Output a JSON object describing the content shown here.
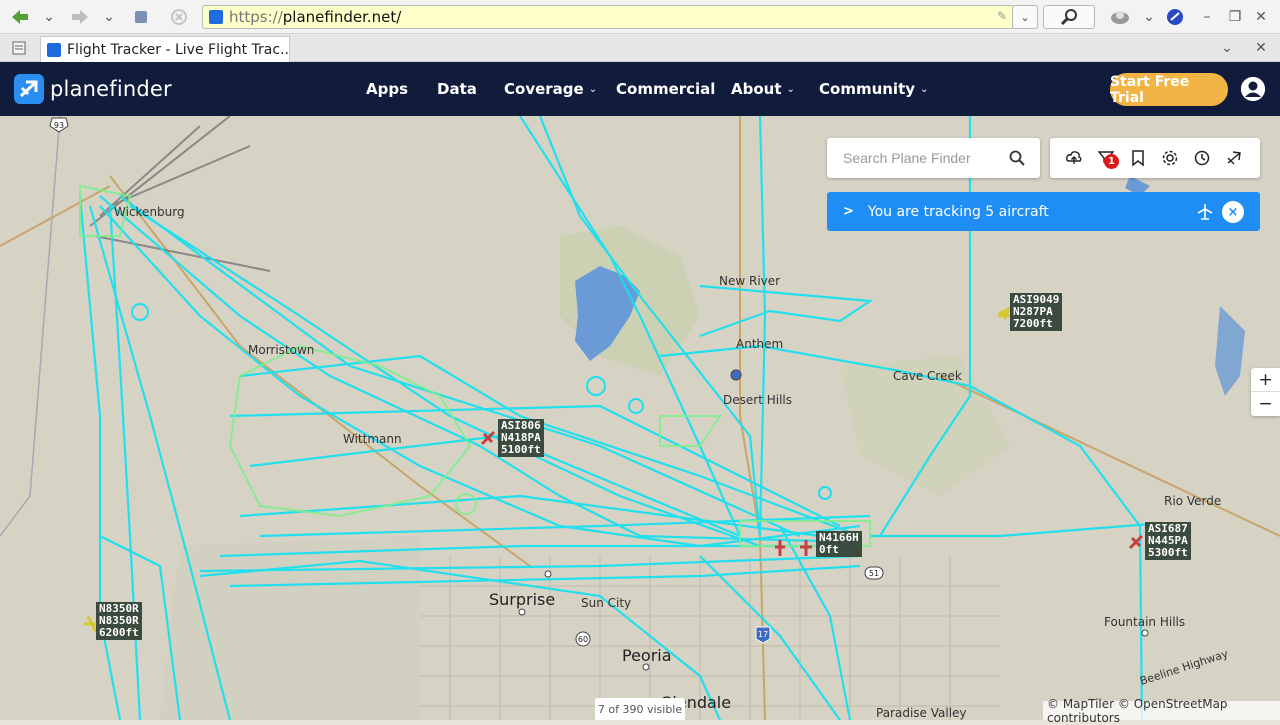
{
  "browser": {
    "url_scheme": "https://",
    "url_host": "planefinder.net/",
    "tab_title": "Flight Tracker - Live Flight Trac..."
  },
  "header": {
    "logo_text": "planefinder",
    "nav": [
      {
        "label": "Apps",
        "has_dropdown": false
      },
      {
        "label": "Data",
        "has_dropdown": false
      },
      {
        "label": "Coverage",
        "has_dropdown": true
      },
      {
        "label": "Commercial",
        "has_dropdown": false
      },
      {
        "label": "About",
        "has_dropdown": true
      },
      {
        "label": "Community",
        "has_dropdown": true
      }
    ],
    "trial_button": "Start Free Trial",
    "accent_color": "#f2b545",
    "bg_color": "#111b3c"
  },
  "search": {
    "placeholder": "Search Plane Finder"
  },
  "tools": {
    "icons": [
      "cloud-upload-icon",
      "filter-icon",
      "bookmark-icon",
      "settings-icon",
      "history-icon",
      "playback-icon"
    ],
    "alert_count": "1"
  },
  "tracking": {
    "text": "You are tracking 5 aircraft",
    "arrow": ">",
    "close": "×"
  },
  "zoom": {
    "in": "+",
    "out": "−"
  },
  "map": {
    "places": [
      {
        "name": "Wickenburg",
        "size": "small"
      },
      {
        "name": "New River",
        "size": "small"
      },
      {
        "name": "Cave Creek",
        "size": "small"
      },
      {
        "name": "Desert Hills",
        "size": "small"
      },
      {
        "name": "Anthem",
        "size": "small"
      },
      {
        "name": "Morristown",
        "size": "small"
      },
      {
        "name": "Wittmann",
        "size": "small"
      },
      {
        "name": "Rio Verde",
        "size": "small"
      },
      {
        "name": "Surprise",
        "size": "big"
      },
      {
        "name": "Sun City",
        "size": "small"
      },
      {
        "name": "Peoria",
        "size": "big"
      },
      {
        "name": "Glendale",
        "size": "big"
      },
      {
        "name": "Fountain Hills",
        "size": "small"
      },
      {
        "name": "Paradise Valley",
        "size": "small"
      },
      {
        "name": "Beeline Highway",
        "size": "small"
      }
    ],
    "aircraft": [
      {
        "lines": [
          "ASI9049",
          "N287PA",
          "7200ft"
        ]
      },
      {
        "lines": [
          "ASI806",
          "N418PA",
          "5100ft"
        ]
      },
      {
        "lines": [
          "N4166H",
          "0ft"
        ]
      },
      {
        "lines": [
          "ASI687",
          "N445PA",
          "5300ft"
        ]
      },
      {
        "lines": [
          "N8350R",
          "N8350R",
          "6200ft"
        ]
      }
    ],
    "shields": [
      "93",
      "60",
      "17",
      "51"
    ],
    "track_color": "#19e0f0",
    "track_color_alt": "#7cf08a"
  },
  "footer": {
    "visible_count": "7 of 390 visible",
    "attribution": "© MapTiler © OpenStreetMap contributors"
  }
}
